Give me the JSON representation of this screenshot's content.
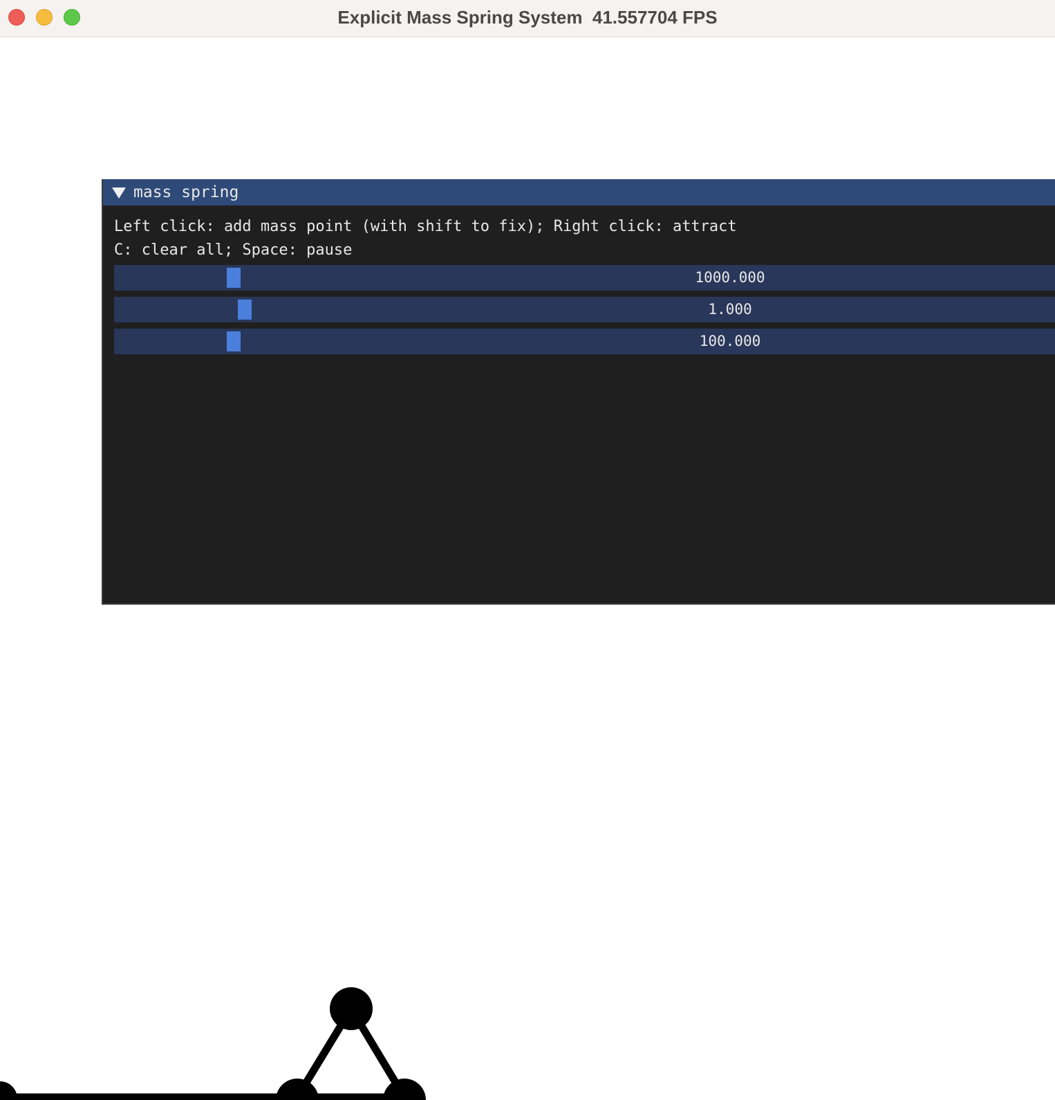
{
  "window": {
    "title": "Explicit Mass Spring System  41.557704 FPS",
    "controls": {
      "close_color": "#ee5e57",
      "minimize_color": "#f6bc3e",
      "zoom_color": "#5ec84b"
    }
  },
  "panel": {
    "title": "mass spring",
    "expanded": true,
    "help_lines": [
      "Left click: add mass point (with shift to fix); Right click: attract",
      "C: clear all; Space: pause"
    ],
    "sliders": [
      {
        "value_text": "1000.000"
      },
      {
        "value_text": "1.000"
      },
      {
        "value_text": "100.000"
      }
    ],
    "colors": {
      "header": "#2e4a78",
      "body": "#1f1f1f",
      "slider_bg": "#29375a",
      "slider_grab": "#4b7fdc"
    }
  },
  "scene": {
    "mass_point_color": "#000000",
    "spring_color": "#000000"
  }
}
